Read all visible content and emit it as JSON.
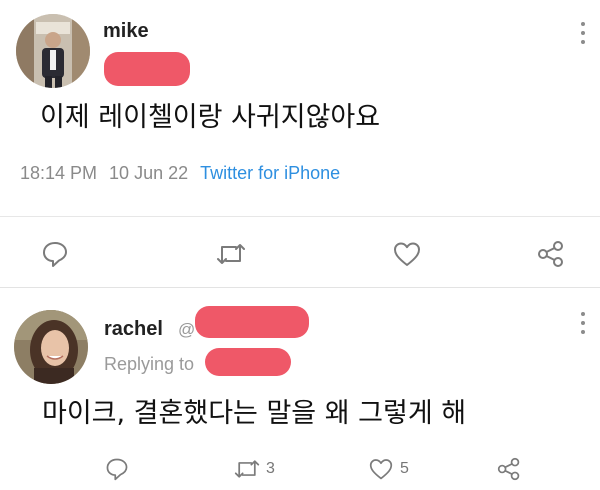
{
  "tweets": [
    {
      "author": "mike",
      "text": "이제 레이첼이랑 사귀지않아요",
      "time": "18:14 PM",
      "date": "10 Jun 22",
      "source": "Twitter for iPhone",
      "actions": {
        "reply_icon": "reply-icon",
        "retweet_icon": "retweet-icon",
        "like_icon": "heart-icon",
        "share_icon": "share-icon"
      }
    },
    {
      "author": "rachel",
      "handle_prefix": "@",
      "replying_label": "Replying to",
      "text": "마이크, 결혼했다는 말을 왜 그렇게 해",
      "retweet_count": "3",
      "like_count": "5",
      "actions": {
        "reply_icon": "reply-icon",
        "retweet_icon": "retweet-icon",
        "like_icon": "heart-icon",
        "share_icon": "share-icon"
      }
    }
  ],
  "colors": {
    "redaction": "#ef5868",
    "source_link": "#2e8fe0",
    "meta_text": "#8a8a8a"
  }
}
